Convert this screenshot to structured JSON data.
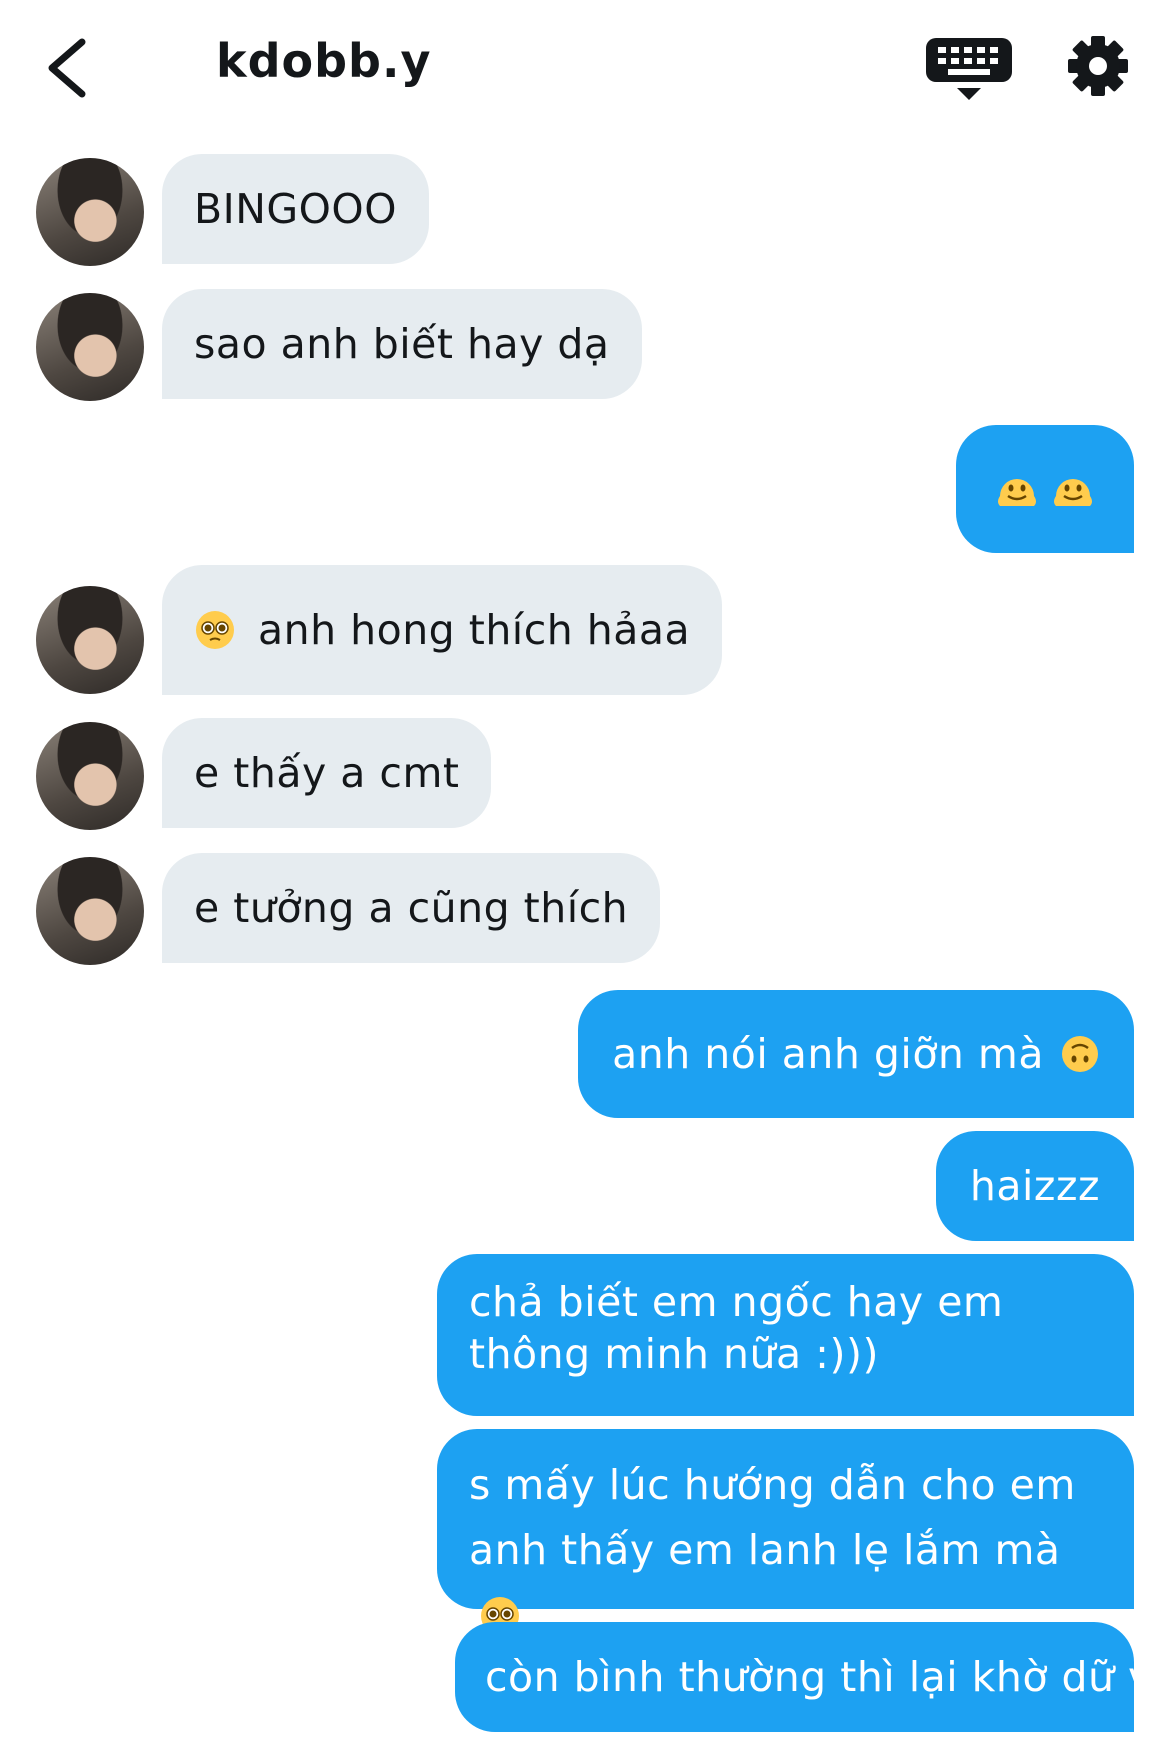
{
  "header": {
    "username": "kdobb.y",
    "back_icon": "chevron-left-icon",
    "keyboard_icon": "keyboard-icon",
    "settings_icon": "gear-icon"
  },
  "colors": {
    "incoming_bubble": "#e6ecf0",
    "outgoing_bubble": "#1da1f2",
    "outgoing_text": "#ffffff",
    "incoming_text": "#14171a"
  },
  "messages": [
    {
      "from": "them",
      "text": "BINGOOO"
    },
    {
      "from": "them",
      "text": "sao anh biết hay dạ"
    },
    {
      "from": "me",
      "text": "🫠🫠",
      "emoji": "melting-face-icon"
    },
    {
      "from": "them",
      "text": "anh hong thích hảaa",
      "emoji": "pleading-face-icon"
    },
    {
      "from": "them",
      "text": "e thấy a cmt"
    },
    {
      "from": "them",
      "text": "e tưởng a cũng thích"
    },
    {
      "from": "me",
      "text": "anh nói anh giỡn mà",
      "emoji": "upside-down-face-icon"
    },
    {
      "from": "me",
      "text": "haizzz"
    },
    {
      "from": "me",
      "text": "chả biết em ngốc hay em thông minh nữa :)))"
    },
    {
      "from": "me",
      "text": "s mấy lúc hướng dẫn cho em anh thấy em lanh lẹ lắm mà",
      "emoji": "pleading-face-icon"
    },
    {
      "from": "me",
      "text": "còn bình thường thì lại khờ dữ v hả"
    }
  ]
}
